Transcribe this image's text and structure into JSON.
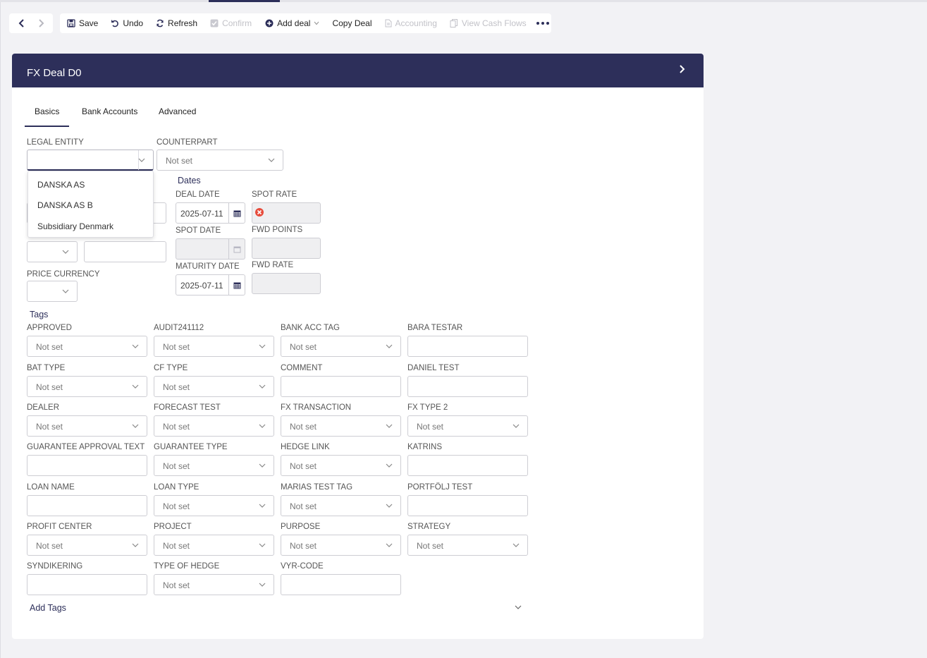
{
  "toolbar": {
    "save": "Save",
    "undo": "Undo",
    "refresh": "Refresh",
    "confirm": "Confirm",
    "add_deal": "Add deal",
    "copy_deal": "Copy Deal",
    "accounting": "Accounting",
    "view_cash_flows": "View Cash Flows"
  },
  "header": {
    "title": "FX Deal D0"
  },
  "tabs": [
    {
      "label": "Basics"
    },
    {
      "label": "Bank Accounts"
    },
    {
      "label": "Advanced"
    }
  ],
  "basics": {
    "legal_entity_label": "LEGAL ENTITY",
    "legal_entity_value": "",
    "counterpart_label": "COUNTERPART",
    "counterpart_value": "Not set",
    "legal_entity_options": [
      "DANSKA AS",
      "DANSKA AS B",
      "Subsidiary Denmark"
    ],
    "price_currency_label": "PRICE CURRENCY"
  },
  "dates": {
    "section": "Dates",
    "deal_date_label": "DEAL DATE",
    "deal_date_value": "2025-07-11",
    "spot_date_label": "SPOT DATE",
    "spot_date_value": "",
    "maturity_date_label": "MATURITY DATE",
    "maturity_date_value": "2025-07-11",
    "spot_rate_label": "SPOT RATE",
    "fwd_points_label": "FWD POINTS",
    "fwd_rate_label": "FWD RATE"
  },
  "tags": {
    "section": "Tags",
    "placeholder": "Not set",
    "items": [
      {
        "label": "APPROVED",
        "kind": "select"
      },
      {
        "label": "AUDIT241112",
        "kind": "select"
      },
      {
        "label": "BANK ACC TAG",
        "kind": "select"
      },
      {
        "label": "BARA TESTAR",
        "kind": "text"
      },
      {
        "label": "BAT TYPE",
        "kind": "select"
      },
      {
        "label": "CF TYPE",
        "kind": "select"
      },
      {
        "label": "COMMENT",
        "kind": "text"
      },
      {
        "label": "DANIEL TEST",
        "kind": "text"
      },
      {
        "label": "DEALER",
        "kind": "select"
      },
      {
        "label": "FORECAST TEST",
        "kind": "select"
      },
      {
        "label": "FX TRANSACTION",
        "kind": "select"
      },
      {
        "label": "FX TYPE 2",
        "kind": "select"
      },
      {
        "label": "GUARANTEE APPROVAL TEXT",
        "kind": "text"
      },
      {
        "label": "GUARANTEE TYPE",
        "kind": "select"
      },
      {
        "label": "HEDGE LINK",
        "kind": "select"
      },
      {
        "label": "KATRINS",
        "kind": "text"
      },
      {
        "label": "LOAN NAME",
        "kind": "text"
      },
      {
        "label": "LOAN TYPE",
        "kind": "select"
      },
      {
        "label": "MARIAS TEST TAG",
        "kind": "select"
      },
      {
        "label": "PORTFÖLJ TEST",
        "kind": "text"
      },
      {
        "label": "PROFIT CENTER",
        "kind": "select"
      },
      {
        "label": "PROJECT",
        "kind": "select"
      },
      {
        "label": "PURPOSE",
        "kind": "select"
      },
      {
        "label": "STRATEGY",
        "kind": "select"
      },
      {
        "label": "SYNDIKERING",
        "kind": "text"
      },
      {
        "label": "TYPE OF HEDGE",
        "kind": "select"
      },
      {
        "label": "VYR-CODE",
        "kind": "text"
      }
    ],
    "add_tags": "Add Tags"
  },
  "colors": {
    "primary": "#2d2f5a",
    "error": "#e74c3c",
    "disabled": "#c2c2c8"
  }
}
